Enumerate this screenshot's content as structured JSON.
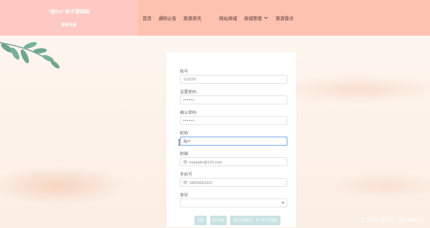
{
  "header": {
    "brand_title": "“旅Go”亲子游网站",
    "brand_subtitle": "尊享出游",
    "nav": [
      {
        "label": "首页"
      },
      {
        "label": "通知公告"
      },
      {
        "label": "旅游资讯"
      },
      {
        "label": "网站商城"
      },
      {
        "label": "商城管理"
      },
      {
        "label": "旅游景点"
      }
    ]
  },
  "form": {
    "fields": [
      {
        "label": "账号",
        "value": "112233",
        "placeholder": ""
      },
      {
        "label": "设置密码",
        "value": "••••••",
        "placeholder": ""
      },
      {
        "label": "确认密码",
        "value": "••••••",
        "placeholder": ""
      },
      {
        "label": "昵称",
        "value": "用户",
        "placeholder": ""
      },
      {
        "label": "邮箱",
        "value": "",
        "placeholder": "例: example@123.com"
      },
      {
        "label": "手机号",
        "value": "",
        "placeholder": "例: 18655552312"
      },
      {
        "label": "身份",
        "value": "",
        "placeholder": ""
      }
    ],
    "buttons": [
      {
        "label": "注册"
      },
      {
        "label": "用户注册"
      },
      {
        "label": "我已注册账号，下一步门户登录"
      }
    ]
  },
  "watermark": "CSDN @VX_ShCX8820",
  "colors": {
    "header_bg": "#ffc2b1",
    "brand_bg": "#ffc9c3",
    "page_bg": "#fbeee4",
    "button_bg": "#c9e4e2",
    "leaf": "#6fa58f"
  },
  "icons": {
    "nav_dropdown": "chevron-down-icon",
    "select_arrow": "select-arrow-icon",
    "decor": "leaf-branch-icon",
    "cursor": "text-cursor-icon"
  }
}
